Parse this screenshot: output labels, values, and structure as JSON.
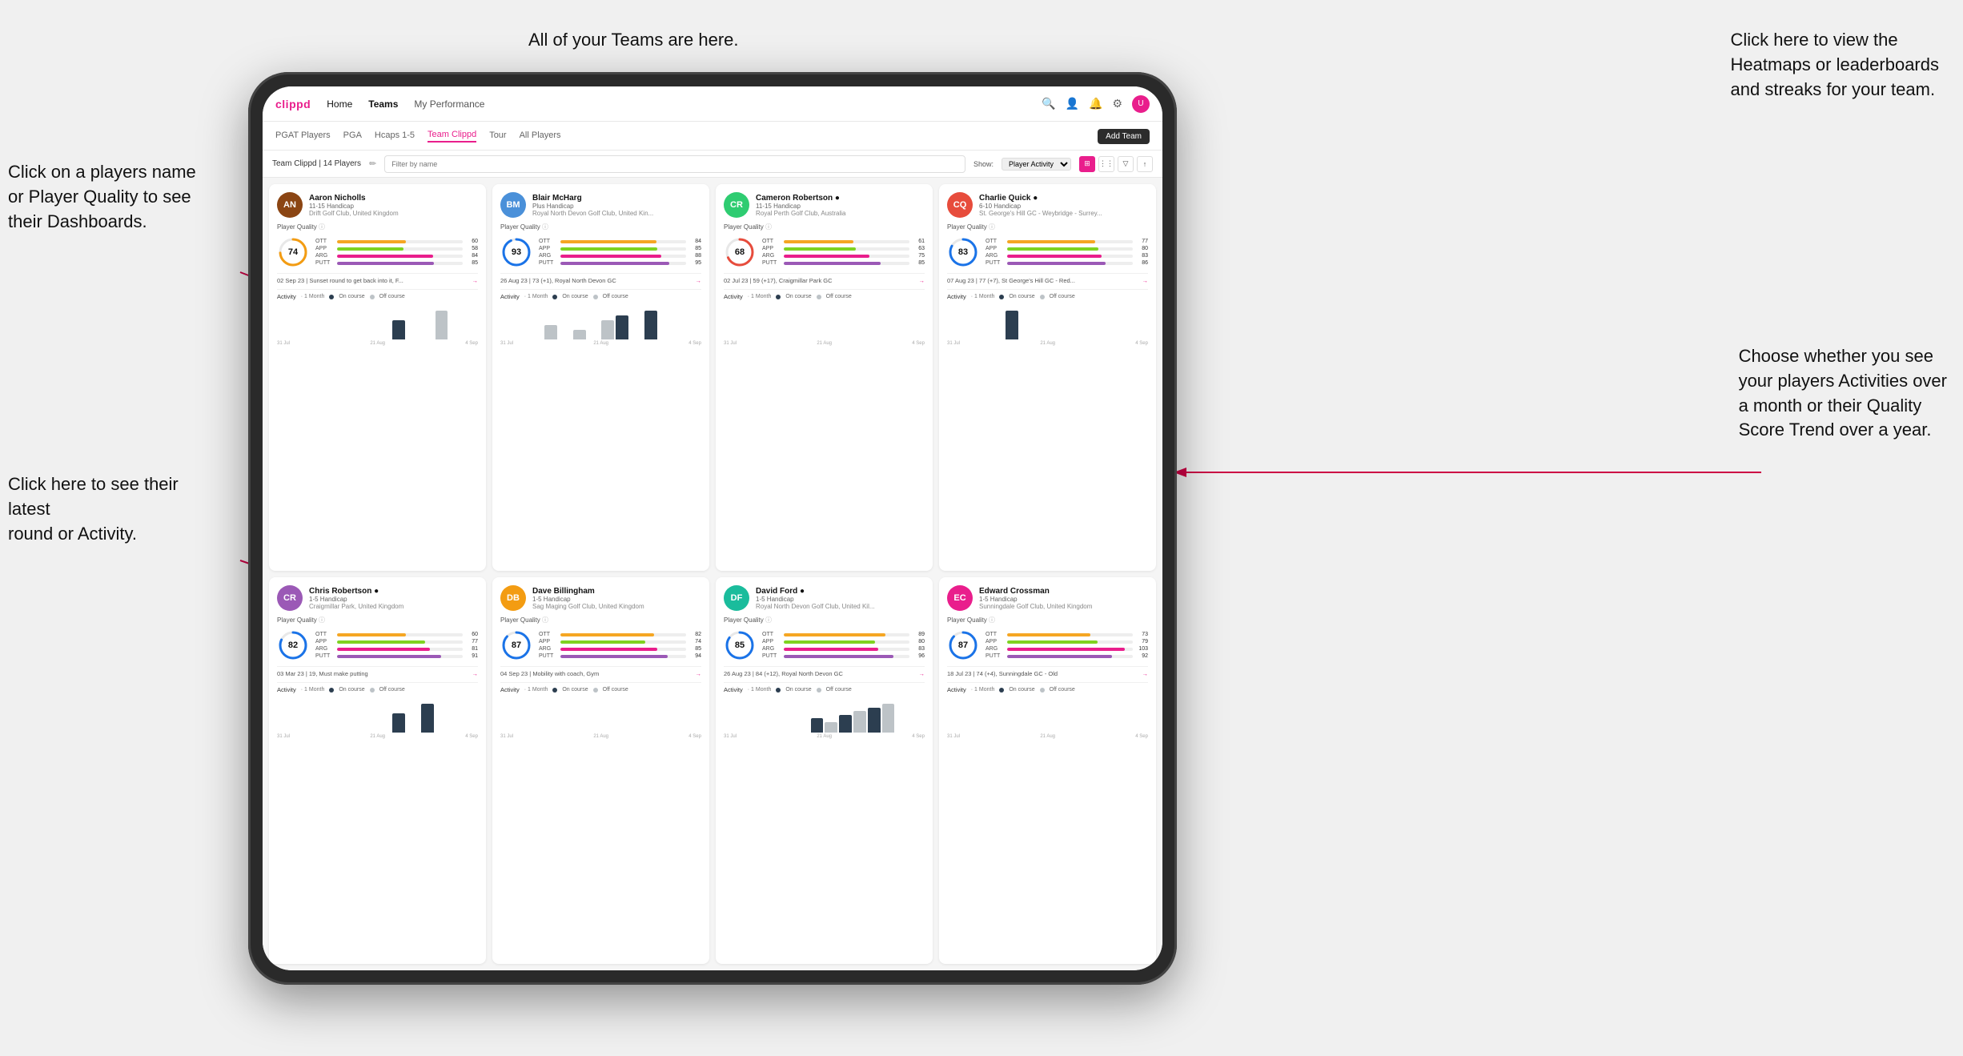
{
  "annotations": {
    "click_player": "Click on a players name\nor Player Quality to see\ntheir Dashboards.",
    "teams_here": "All of your Teams are here.",
    "heatmaps": "Click here to view the\nHeatmaps or leaderboards\nand streaks for your team.",
    "click_round": "Click here to see their latest\nround or Activity.",
    "activities": "Choose whether you see\nyour players Activities over\na month or their Quality\nScore Trend over a year."
  },
  "navbar": {
    "brand": "clippd",
    "items": [
      "Home",
      "Teams",
      "My Performance"
    ],
    "active": "Teams"
  },
  "subnav": {
    "items": [
      "PGAT Players",
      "PGA",
      "Hcaps 1-5",
      "Team Clippd",
      "Tour",
      "All Players"
    ],
    "active": "Team Clippd",
    "add_team_label": "Add Team"
  },
  "teambar": {
    "title": "Team Clippd | 14 Players",
    "search_placeholder": "Filter by name",
    "show_label": "Show:",
    "show_option": "Player Activity",
    "view_options": [
      "⊞",
      "⋮⋮",
      "▼",
      "↑"
    ]
  },
  "players": [
    {
      "name": "Aaron Nicholls",
      "handicap": "11-15 Handicap",
      "club": "Drift Golf Club, United Kingdom",
      "quality": 74,
      "ott": 60,
      "app": 58,
      "arg": 84,
      "putt": 85,
      "recent": "02 Sep 23 | Sunset round to get back into it, F...",
      "chart_bars": [
        0,
        0,
        0,
        0,
        0,
        0,
        0,
        0,
        2,
        0,
        0,
        3,
        0,
        0
      ],
      "dates": [
        "31 Jul",
        "21 Aug",
        "4 Sep"
      ]
    },
    {
      "name": "Blair McHarg",
      "handicap": "Plus Handicap",
      "club": "Royal North Devon Golf Club, United Kin...",
      "quality": 93,
      "ott": 84,
      "app": 85,
      "arg": 88,
      "putt": 95,
      "recent": "26 Aug 23 | 73 (+1), Royal North Devon GC",
      "chart_bars": [
        0,
        0,
        0,
        3,
        0,
        2,
        0,
        4,
        5,
        0,
        6,
        0,
        0,
        0
      ],
      "dates": [
        "31 Jul",
        "21 Aug",
        "4 Sep"
      ]
    },
    {
      "name": "Cameron Robertson",
      "handicap": "11-15 Handicap",
      "club": "Royal Perth Golf Club, Australia",
      "quality": 68,
      "ott": 61,
      "app": 63,
      "arg": 75,
      "putt": 85,
      "recent": "02 Jul 23 | 59 (+17), Craigmillar Park GC",
      "chart_bars": [
        0,
        0,
        0,
        0,
        0,
        0,
        0,
        0,
        0,
        0,
        0,
        0,
        0,
        0
      ],
      "dates": [
        "31 Jul",
        "21 Aug",
        "4 Sep"
      ]
    },
    {
      "name": "Charlie Quick",
      "handicap": "6-10 Handicap",
      "club": "St. George's Hill GC - Weybridge - Surrey...",
      "quality": 83,
      "ott": 77,
      "app": 80,
      "arg": 83,
      "putt": 86,
      "recent": "07 Aug 23 | 77 (+7), St George's Hill GC - Red...",
      "chart_bars": [
        0,
        0,
        0,
        0,
        3,
        0,
        0,
        0,
        0,
        0,
        0,
        0,
        0,
        0
      ],
      "dates": [
        "31 Jul",
        "21 Aug",
        "4 Sep"
      ]
    },
    {
      "name": "Chris Robertson",
      "handicap": "1-5 Handicap",
      "club": "Craigmillar Park, United Kingdom",
      "quality": 82,
      "ott": 60,
      "app": 77,
      "arg": 81,
      "putt": 91,
      "recent": "03 Mar 23 | 19, Must make putting",
      "chart_bars": [
        0,
        0,
        0,
        0,
        0,
        0,
        0,
        0,
        2,
        0,
        3,
        0,
        0,
        0
      ],
      "dates": [
        "31 Jul",
        "21 Aug",
        "4 Sep"
      ]
    },
    {
      "name": "Dave Billingham",
      "handicap": "1-5 Handicap",
      "club": "Sag Maging Golf Club, United Kingdom",
      "quality": 87,
      "ott": 82,
      "app": 74,
      "arg": 85,
      "putt": 94,
      "recent": "04 Sep 23 | Mobility with coach, Gym",
      "chart_bars": [
        0,
        0,
        0,
        0,
        0,
        0,
        0,
        0,
        0,
        0,
        0,
        0,
        0,
        0
      ],
      "dates": [
        "31 Jul",
        "21 Aug",
        "4 Sep"
      ]
    },
    {
      "name": "David Ford",
      "handicap": "1-5 Handicap",
      "club": "Royal North Devon Golf Club, United Kil...",
      "quality": 85,
      "ott": 89,
      "app": 80,
      "arg": 83,
      "putt": 96,
      "recent": "26 Aug 23 | 84 (+12), Royal North Devon GC",
      "chart_bars": [
        0,
        0,
        0,
        0,
        0,
        0,
        4,
        3,
        5,
        6,
        7,
        8,
        0,
        0
      ],
      "dates": [
        "31 Jul",
        "21 Aug",
        "4 Sep"
      ]
    },
    {
      "name": "Edward Crossman",
      "handicap": "1-5 Handicap",
      "club": "Sunningdale Golf Club, United Kingdom",
      "quality": 87,
      "ott": 73,
      "app": 79,
      "arg": 103,
      "putt": 92,
      "recent": "18 Jul 23 | 74 (+4), Sunningdale GC - Old",
      "chart_bars": [
        0,
        0,
        0,
        0,
        0,
        0,
        0,
        0,
        0,
        0,
        0,
        0,
        0,
        0
      ],
      "dates": [
        "31 Jul",
        "21 Aug",
        "4 Sep"
      ]
    }
  ],
  "colors": {
    "brand": "#e91e8c",
    "ott": "#f5a623",
    "app": "#7ed321",
    "arg": "#e91e8c",
    "putt": "#9b59b6",
    "on_course": "#2c3e50",
    "off_course": "#bdc3c7",
    "circle_blue": "#1a73e8",
    "circle_track": "#e8e8e8"
  }
}
